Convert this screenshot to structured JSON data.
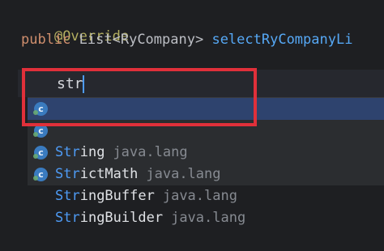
{
  "code": {
    "annotation": "@Override",
    "signature": {
      "modifier": "public",
      "return_type": "List<RyCompany>",
      "method_name": "selectRyCompanyLi"
    },
    "open_brace": "{",
    "close_brace": "}",
    "typed_text": "str"
  },
  "completion": {
    "items": [
      {
        "match": "Str",
        "rest": "ing",
        "package": "java.lang",
        "selected": true
      },
      {
        "match": "Str",
        "rest": "ictMath",
        "package": "java.lang",
        "selected": false
      },
      {
        "match": "Str",
        "rest": "ingBuffer",
        "package": "java.lang",
        "selected": false
      },
      {
        "match": "Str",
        "rest": "ingBuilder",
        "package": "java.lang",
        "selected": false
      }
    ],
    "icon_letter": "c",
    "icon": "class-icon"
  },
  "colors": {
    "highlight_box": "#e0303a",
    "selection": "#2e436e",
    "match": "#4e9bf5"
  }
}
